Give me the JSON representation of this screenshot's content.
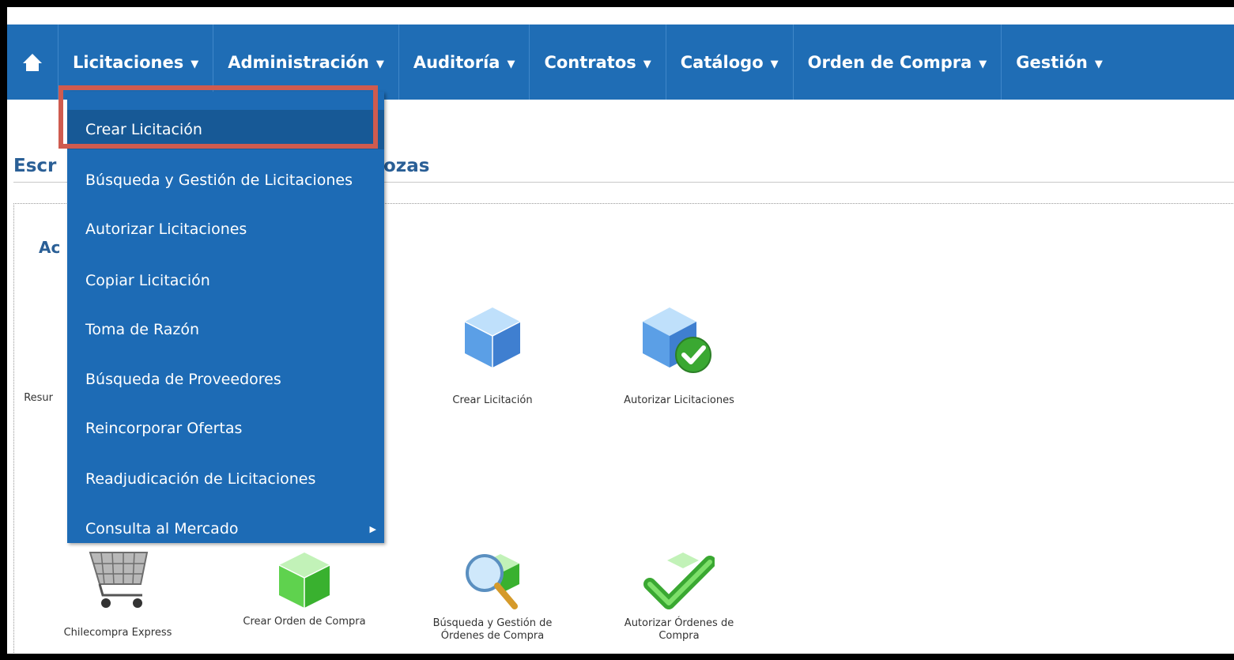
{
  "nav": {
    "home_icon": "home-icon",
    "items": [
      {
        "label": "Licitaciones"
      },
      {
        "label": "Administración"
      },
      {
        "label": "Auditoría"
      },
      {
        "label": "Contratos"
      },
      {
        "label": "Catálogo"
      },
      {
        "label": "Orden de Compra"
      },
      {
        "label": "Gestión"
      }
    ],
    "caret": "▼"
  },
  "page": {
    "title_visible": "Escr",
    "title_suffix": "ozas",
    "section_title": "Ac"
  },
  "tiles": {
    "resumen": "Resur",
    "crear_licitacion": "Crear Licitación",
    "autorizar_licitaciones": "Autorizar Licitaciones",
    "chilecompra_express": "Chilecompra Express",
    "crear_orden": "Crear Orden de Compra",
    "busqueda_ordenes_1": "Búsqueda y Gestión de",
    "busqueda_ordenes_2": "Órdenes de Compra",
    "autorizar_ordenes_1": "Autorizar Órdenes de",
    "autorizar_ordenes_2": "Compra"
  },
  "dropdown": {
    "items": [
      {
        "label": "Crear Licitación"
      },
      {
        "label": "Búsqueda y Gestión de Licitaciones"
      },
      {
        "label": "Autorizar Licitaciones"
      },
      {
        "label": "Copiar Licitación"
      },
      {
        "label": "Toma de Razón"
      },
      {
        "label": "Búsqueda de Proveedores"
      },
      {
        "label": "Reincorporar Ofertas"
      },
      {
        "label": "Readjudicación de Licitaciones"
      },
      {
        "label": "Consulta al Mercado"
      }
    ],
    "submenu_arrow": "▶"
  },
  "colors": {
    "nav_bg": "#1f6db5",
    "menu_bg": "#1d6bb5",
    "menu_active": "#175996",
    "highlight": "#cf5b4f",
    "title": "#2a5f96"
  }
}
